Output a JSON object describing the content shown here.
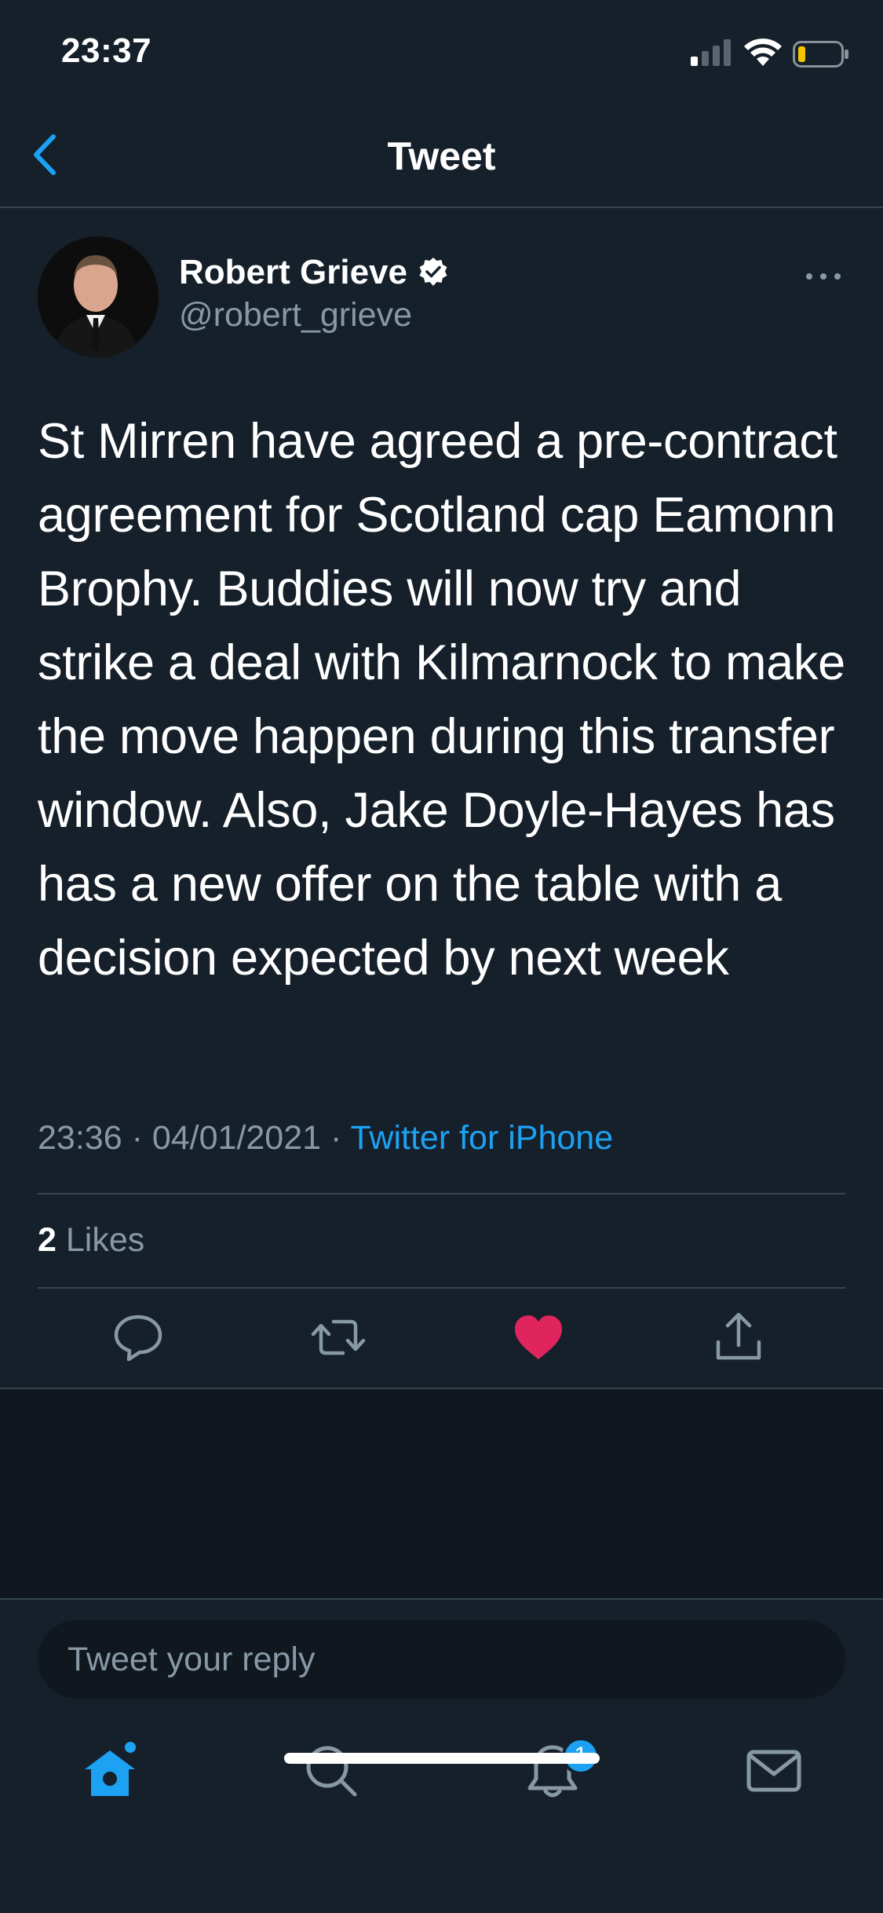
{
  "status_bar": {
    "time": "23:37"
  },
  "nav": {
    "title": "Tweet"
  },
  "tweet": {
    "author_name": "Robert Grieve",
    "author_handle": "@robert_grieve",
    "text": "St Mirren have agreed a pre-contract agreement for Scotland cap Eamonn Brophy. Buddies will now try and strike a deal with Kilmarnock to make the move happen during this transfer window. Also, Jake Doyle-Hayes has has a new offer on the table with a decision expected by next week",
    "time": "23:36",
    "separator": "·",
    "date": "04/01/2021",
    "source": "Twitter for iPhone",
    "likes_count": "2",
    "likes_label": "Likes",
    "liked": true
  },
  "reply": {
    "placeholder": "Tweet your reply"
  },
  "tabs": {
    "notifications_badge": "1",
    "items": [
      "home-icon",
      "search-icon",
      "bell-icon",
      "mail-icon"
    ]
  },
  "colors": {
    "background": "#15202b",
    "accent": "#1da1f2",
    "like": "#e0245e",
    "secondary_text": "#8899a6"
  }
}
